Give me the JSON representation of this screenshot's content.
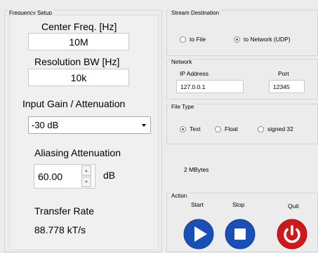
{
  "frequency_setup": {
    "title": "Frequency Setup",
    "center_freq_label": "Center Freq. [Hz]",
    "center_freq_value": "10M",
    "resolution_bw_label": "Resolution BW [Hz]",
    "resolution_bw_value": "10k",
    "input_gain_label": "Input Gain / Attenuation",
    "input_gain_selected": "-30 dB",
    "aliasing_label": "Aliasing Attenuation",
    "aliasing_value": "60.00",
    "aliasing_unit": "dB",
    "transfer_rate_label": "Transfer Rate",
    "transfer_rate_value": "88.778 kT/s"
  },
  "stream_destination": {
    "title": "Stream Destination",
    "options": [
      {
        "label": "to File",
        "selected": false
      },
      {
        "label": "to Network (UDP)",
        "selected": true
      }
    ]
  },
  "network": {
    "title": "Network",
    "ip_label": "IP Address",
    "ip_value": "127.0.0.1",
    "port_label": "Port",
    "port_value": "12345"
  },
  "file_type": {
    "title": "File Type",
    "options": [
      {
        "label": "Text",
        "selected": true
      },
      {
        "label": "Float",
        "selected": false
      },
      {
        "label": "signed 32",
        "selected": false
      }
    ]
  },
  "size_text": "2 MBytes",
  "action": {
    "title": "Action",
    "start_label": "Start",
    "stop_label": "Stop",
    "quit_label": "Quit",
    "start_icon": "play-icon",
    "stop_icon": "stop-icon",
    "quit_icon": "power-icon",
    "colors": {
      "blue": "#1a4fb5",
      "red": "#d0171b"
    }
  }
}
